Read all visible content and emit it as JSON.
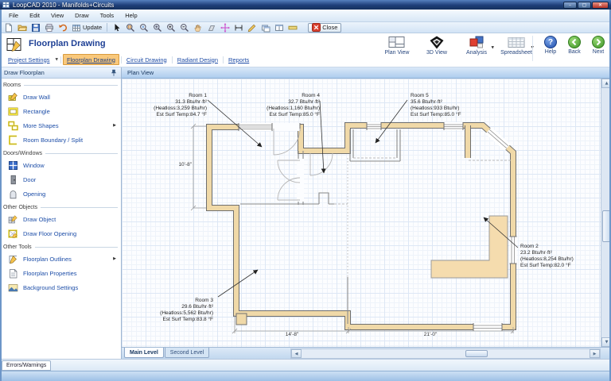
{
  "window": {
    "title": "LoopCAD 2010 - Manifolds+Circuits",
    "controls": {
      "minimize": "–",
      "maximize": "▢",
      "close": "✕"
    }
  },
  "menubar": {
    "items": [
      "File",
      "Edit",
      "View",
      "Draw",
      "Tools",
      "Help"
    ]
  },
  "toolbar": {
    "update_label": "Update",
    "close_label": "Close",
    "icons": [
      "new",
      "open",
      "save",
      "print",
      "undo",
      "update",
      "pointer",
      "zoom-window",
      "zoom-object",
      "zoom-extents",
      "zoom-in",
      "zoom-out",
      "pan",
      "transform",
      "move",
      "measure",
      "draw-line",
      "cascade",
      "tile",
      "ruler",
      "close"
    ]
  },
  "ribbon": {
    "title": "Floorplan Drawing",
    "tabs": [
      {
        "label": "Project Settings",
        "active": false,
        "dropdown": true
      },
      {
        "label": "Floorplan Drawing",
        "active": true
      },
      {
        "label": "Circuit Drawing",
        "active": false
      },
      {
        "label": "Radiant Design",
        "active": false
      },
      {
        "label": "Reports",
        "active": false
      }
    ],
    "views": [
      {
        "label": "Plan View",
        "icon": "plan-view"
      },
      {
        "label": "3D View",
        "icon": "3d-view"
      },
      {
        "label": "Analysis",
        "icon": "analysis",
        "dropdown": true
      },
      {
        "label": "Spreadsheet",
        "icon": "spreadsheet",
        "dropdown": true
      }
    ],
    "nav": [
      {
        "label": "Help",
        "icon": "help-circle"
      },
      {
        "label": "Back",
        "icon": "back-circle"
      },
      {
        "label": "Next",
        "icon": "next-circle"
      }
    ]
  },
  "sidebar": {
    "title": "Draw Floorplan",
    "sections": [
      {
        "title": "Rooms",
        "items": [
          {
            "label": "Draw Wall",
            "icon": "draw-wall"
          },
          {
            "label": "Rectangle",
            "icon": "rectangle"
          },
          {
            "label": "More Shapes",
            "icon": "more-shapes",
            "submenu": true
          },
          {
            "label": "Room Boundary / Split",
            "icon": "room-boundary"
          }
        ]
      },
      {
        "title": "Doors/Windows",
        "items": [
          {
            "label": "Window",
            "icon": "window"
          },
          {
            "label": "Door",
            "icon": "door"
          },
          {
            "label": "Opening",
            "icon": "opening"
          }
        ]
      },
      {
        "title": "Other Objects",
        "items": [
          {
            "label": "Draw Object",
            "icon": "draw-object"
          },
          {
            "label": "Draw Floor Opening",
            "icon": "draw-floor-opening"
          }
        ]
      },
      {
        "title": "Other Tools",
        "items": [
          {
            "label": "Floorplan Outlines",
            "icon": "floorplan-outlines",
            "submenu": true
          },
          {
            "label": "Floorplan Properties",
            "icon": "floorplan-properties"
          },
          {
            "label": "Background Settings",
            "icon": "background-settings"
          }
        ]
      }
    ]
  },
  "canvas": {
    "view_label": "Plan View",
    "rooms": [
      {
        "name": "Room 1",
        "rate": "31.3 Btu/hr·ft²",
        "heatloss": "(Heatloss:3,259 Btu/hr)",
        "surf": "Est Surf Temp:84.7 °F"
      },
      {
        "name": "Room 4",
        "rate": "32.7 Btu/hr·ft²",
        "heatloss": "(Heatloss:1,160 Btu/hr)",
        "surf": "Est Surf Temp:85.0 °F"
      },
      {
        "name": "Room 5",
        "rate": "35.6 Btu/hr·ft²",
        "heatloss": "(Heatloss:933 Btu/hr)",
        "surf": "Est Surf Temp:85.0 °F"
      },
      {
        "name": "Room 2",
        "rate": "23.2 Btu/hr·ft²",
        "heatloss": "(Heatloss:8,254 Btu/hr)",
        "surf": "Est Surf Temp:82.0 °F"
      },
      {
        "name": "Room 3",
        "rate": "29.6 Btu/hr·ft²",
        "heatloss": "(Heatloss:5,562 Btu/hr)",
        "surf": "Est Surf Temp:83.8 °F"
      }
    ],
    "dimensions": {
      "left": "10'-8\"",
      "bottom_left": "14'-8\"",
      "bottom_right": "21'-0\""
    },
    "levels": [
      {
        "label": "Main Level",
        "active": true
      },
      {
        "label": "Second Level",
        "active": false
      }
    ]
  },
  "bottom": {
    "errors_tab": "Errors/Warnings"
  },
  "colors": {
    "accent_orange": "#f9c87b",
    "link_blue": "#1d4ba5",
    "wall_tan": "#f0d9a8",
    "title_blue": "#1e4095"
  }
}
